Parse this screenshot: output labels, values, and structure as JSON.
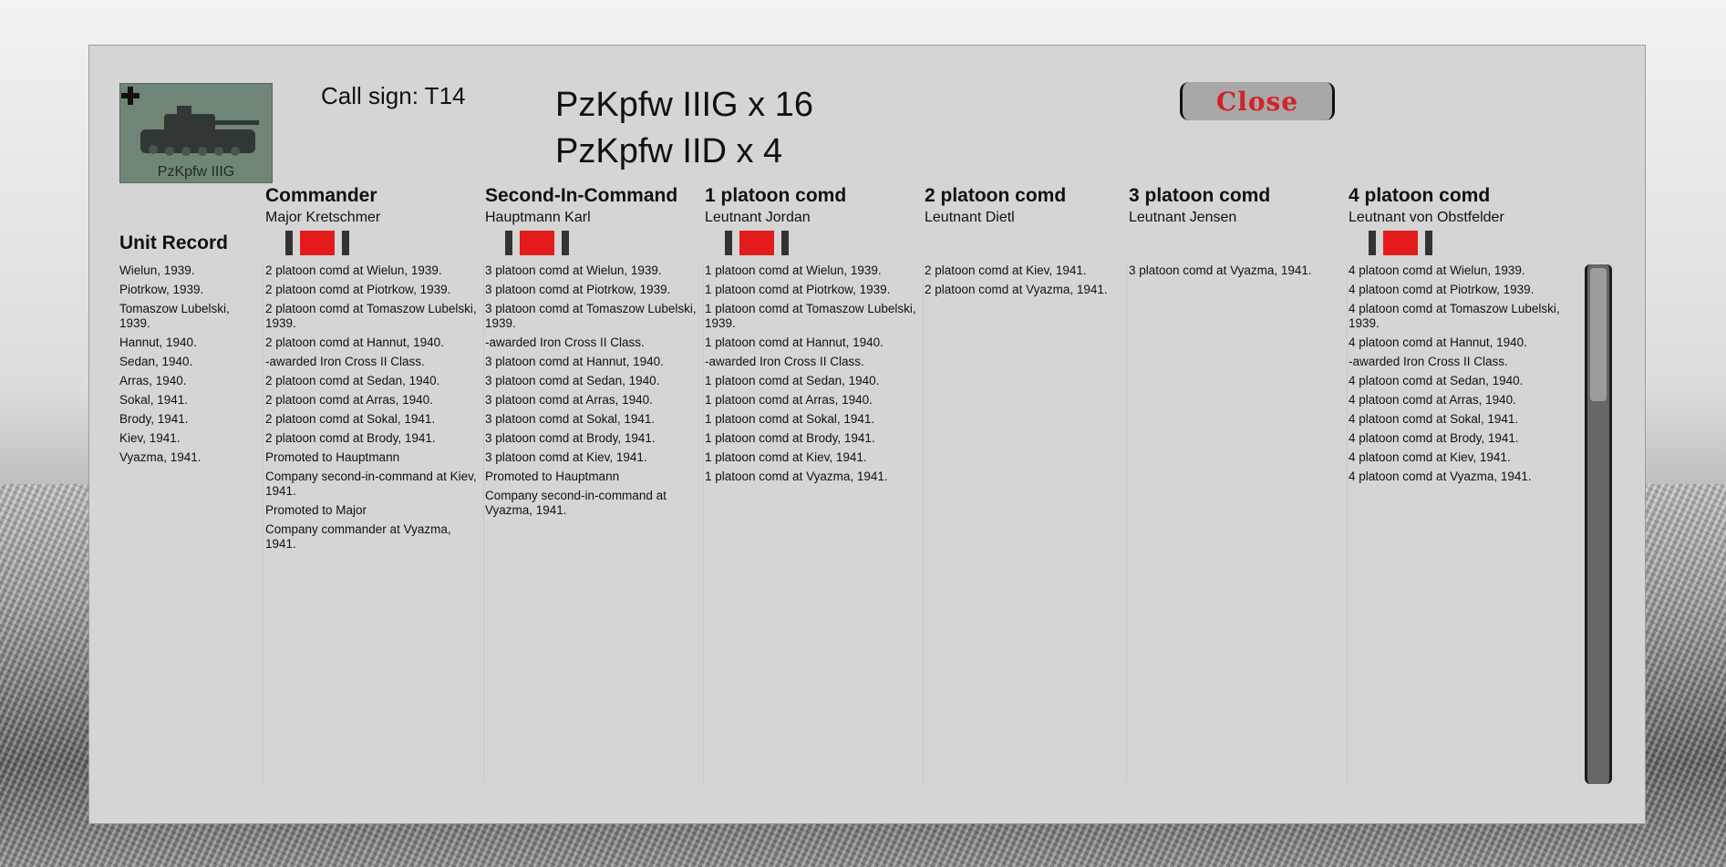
{
  "header": {
    "unit_image_label": "PzKpfw IIIG",
    "call_sign": "Call sign: T14",
    "unit_lines": [
      "PzKpfw IIIG x 16",
      "PzKpfw IID x 4"
    ],
    "close_label": "Close"
  },
  "unit_record": {
    "title": "Unit Record",
    "entries": [
      "Wielun, 1939.",
      "Piotrkow, 1939.",
      "Tomaszow Lubelski, 1939.",
      "Hannut, 1940.",
      "Sedan, 1940.",
      "Arras, 1940.",
      "Sokal, 1941.",
      "Brody, 1941.",
      "Kiev, 1941.",
      "Vyazma, 1941."
    ]
  },
  "columns": [
    {
      "title": "Commander",
      "name": "Major Kretschmer",
      "medal": true,
      "entries": [
        "2 platoon comd at Wielun, 1939.",
        "2 platoon comd at Piotrkow, 1939.",
        "2 platoon comd at Tomaszow Lubelski, 1939.",
        "2 platoon comd at Hannut, 1940.",
        "-awarded Iron Cross II Class.",
        "2 platoon comd at Sedan, 1940.",
        "2 platoon comd at Arras, 1940.",
        "2 platoon comd at Sokal, 1941.",
        "2 platoon comd at Brody, 1941.",
        "Promoted to Hauptmann",
        "Company second-in-command at Kiev, 1941.",
        "Promoted to Major",
        "Company commander at Vyazma, 1941."
      ]
    },
    {
      "title": "Second-In-Command",
      "name": "Hauptmann Karl",
      "medal": true,
      "entries": [
        "3 platoon comd at Wielun, 1939.",
        "3 platoon comd at Piotrkow, 1939.",
        "3 platoon comd at Tomaszow Lubelski, 1939.",
        "-awarded Iron Cross II Class.",
        "3 platoon comd at Hannut, 1940.",
        "3 platoon comd at Sedan, 1940.",
        "3 platoon comd at Arras, 1940.",
        "3 platoon comd at Sokal, 1941.",
        "3 platoon comd at Brody, 1941.",
        "3 platoon comd at Kiev, 1941.",
        "Promoted to Hauptmann",
        "Company second-in-command at Vyazma, 1941."
      ]
    },
    {
      "title": "1 platoon comd",
      "name": "Leutnant Jordan",
      "medal": true,
      "entries": [
        "1 platoon comd at Wielun, 1939.",
        "1 platoon comd at Piotrkow, 1939.",
        "1 platoon comd at Tomaszow Lubelski, 1939.",
        "1 platoon comd at Hannut, 1940.",
        "-awarded Iron Cross II Class.",
        "1 platoon comd at Sedan, 1940.",
        "1 platoon comd at Arras, 1940.",
        "1 platoon comd at Sokal, 1941.",
        "1 platoon comd at Brody, 1941.",
        "1 platoon comd at Kiev, 1941.",
        "1 platoon comd at Vyazma, 1941."
      ]
    },
    {
      "title": "2 platoon comd",
      "name": "Leutnant Dietl",
      "medal": false,
      "entries": [
        "2 platoon comd at Kiev, 1941.",
        "2 platoon comd at Vyazma, 1941."
      ]
    },
    {
      "title": "3 platoon comd",
      "name": "Leutnant Jensen",
      "medal": false,
      "entries": [
        "3 platoon comd at Vyazma, 1941."
      ]
    },
    {
      "title": "4 platoon comd",
      "name": "Leutnant von Obstfelder",
      "medal": true,
      "entries": [
        "4 platoon comd at Wielun, 1939.",
        "4 platoon comd at Piotrkow, 1939.",
        "4 platoon comd at Tomaszow Lubelski, 1939.",
        "4 platoon comd at Hannut, 1940.",
        "-awarded Iron Cross II Class.",
        "4 platoon comd at Sedan, 1940.",
        "4 platoon comd at Arras, 1940.",
        "4 platoon comd at Sokal, 1941.",
        "4 platoon comd at Brody, 1941.",
        "4 platoon comd at Kiev, 1941.",
        "4 platoon comd at Vyazma, 1941."
      ]
    }
  ],
  "scrollbar": {
    "position_fraction": 0.0,
    "visible_fraction": 0.26
  },
  "colors": {
    "medal_red": "#e41b1b",
    "close_text": "#d4212a",
    "panel": "#d5d5d5"
  }
}
